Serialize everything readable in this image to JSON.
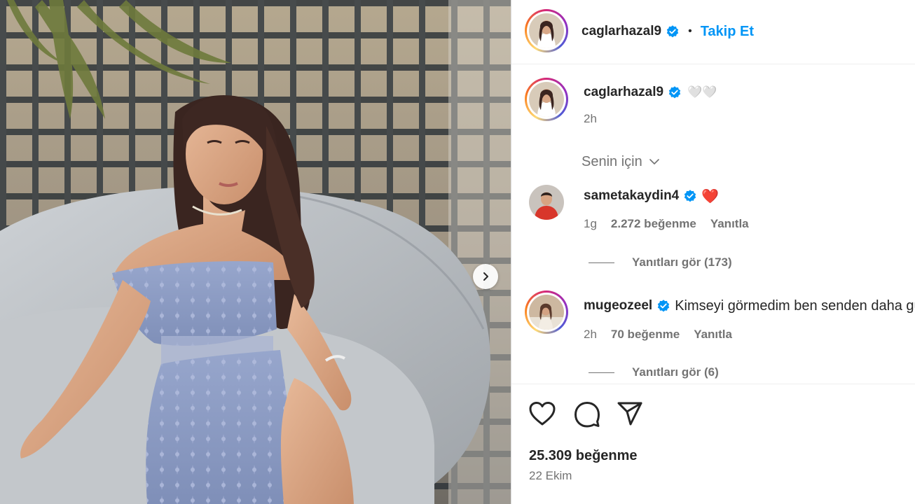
{
  "post": {
    "author": "caglarhazal9",
    "separator": "•",
    "follow_label": "Takip Et",
    "caption_emoji": "🤍🤍",
    "caption_time": "2h",
    "sort_label": "Senin için",
    "likes": "25.309 beğenme",
    "date": "22 Ekim"
  },
  "comments": [
    {
      "user": "sametakaydin4",
      "text": "❤️",
      "time": "1g",
      "likes": "2.272 beğenme",
      "reply_label": "Yanıtla",
      "view_replies": "Yanıtları gör (173)"
    },
    {
      "user": "mugeozeel",
      "text": "Kimseyi görmedim ben senden daha güzel",
      "time": "2h",
      "likes": "70 beğenme",
      "reply_label": "Yanıtla",
      "view_replies": "Yanıtları gör (6)"
    }
  ],
  "colors": {
    "link_blue": "#0095f6",
    "verified_blue": "#0095f6",
    "text_primary": "#262626",
    "text_secondary": "#737373",
    "dress_blue": "#8fa0c8",
    "cushion_gray": "#b8bcc0"
  },
  "icons": {
    "like": "heart-outline-icon",
    "comment": "speech-bubble-icon",
    "share": "paper-plane-icon",
    "next": "chevron-right-icon",
    "sort": "chevron-down-icon",
    "verified": "verified-badge-icon"
  }
}
